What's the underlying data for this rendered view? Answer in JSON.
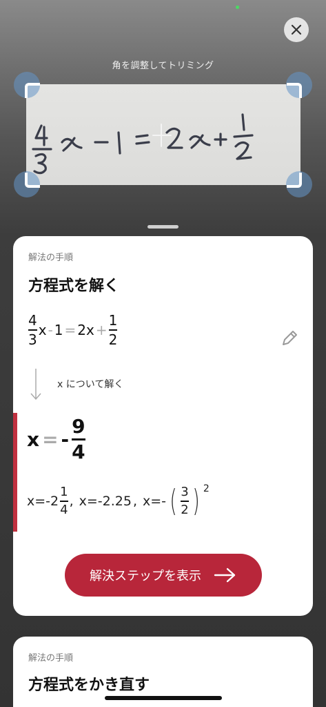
{
  "camera": {
    "crop_hint": "角を調整してトリミング",
    "handwritten_equation": "4/3 x - 1 = 2x + 1/2"
  },
  "card1": {
    "section_label": "解法の手順",
    "title": "方程式を解く",
    "equation": {
      "frac_num": "4",
      "frac_den": "3",
      "x": "x",
      "minus": "-",
      "one": "1",
      "equals": "=",
      "two_x": "2x",
      "plus": "+",
      "rhs_num": "1",
      "rhs_den": "2"
    },
    "step_text": "x について解く",
    "answer": {
      "x": "x",
      "equals": "=",
      "sign": "-",
      "num": "9",
      "den": "4"
    },
    "alt": {
      "a1_prefix": "x=-2",
      "a1_num": "1",
      "a1_den": "4",
      "sep1": ",",
      "a2": "x=-2.25",
      "sep2": ",",
      "a3_prefix": "x=-",
      "a3_open": "(",
      "a3_num": "3",
      "a3_den": "2",
      "a3_close": ")",
      "a3_exp": "2"
    },
    "button_label": "解決ステップを表示"
  },
  "card2": {
    "section_label": "解法の手順",
    "title": "方程式をかき直す"
  },
  "colors": {
    "accent": "#b8263a",
    "handle": "#6496c8",
    "status": "#4cd964"
  },
  "icons": {
    "close": "close-icon",
    "edit": "pencil-icon",
    "arrow_down": "arrow-down-icon",
    "arrow_right": "arrow-right-icon"
  }
}
